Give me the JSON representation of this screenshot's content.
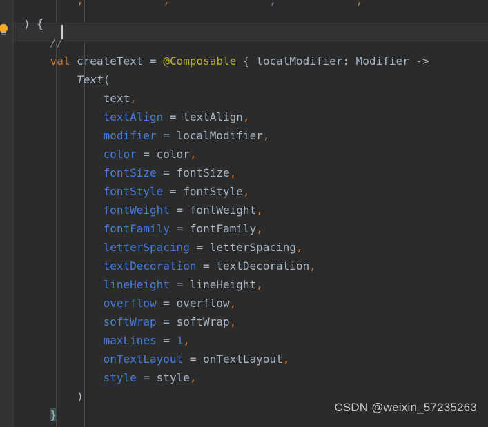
{
  "editor": {
    "theme_name": "darcula",
    "background_color": "#2b2b2b",
    "gutter_color": "#313335",
    "current_line_color": "#323232",
    "caret_color": "#cfcfcf",
    "language": "kotlin"
  },
  "gutter": {
    "intention_icon": "lightbulb-icon",
    "intention_icon_color": "#f5a623"
  },
  "lines": [
    {
      "index": 0,
      "clipped": true,
      "tokens": [
        {
          "text": "        ",
          "type": "default"
        },
        {
          "text": ",",
          "type": "comma"
        },
        {
          "text": "            ",
          "type": "default"
        },
        {
          "text": ",",
          "type": "comma"
        },
        {
          "text": "               ",
          "type": "default"
        },
        {
          "text": ",",
          "type": "local"
        },
        {
          "text": "            ",
          "type": "default"
        },
        {
          "text": ",",
          "type": "comma"
        }
      ]
    },
    {
      "index": 1,
      "tokens": [
        {
          "text": ") {",
          "type": "brace"
        }
      ]
    },
    {
      "index": 2,
      "current": true,
      "tokens": [
        {
          "text": "    ",
          "type": "default"
        },
        {
          "text": "// ",
          "type": "comment"
        }
      ]
    },
    {
      "index": 3,
      "tokens": [
        {
          "text": "    ",
          "type": "default"
        },
        {
          "text": "val",
          "type": "keyword"
        },
        {
          "text": " createText ",
          "type": "ident"
        },
        {
          "text": "=",
          "type": "default"
        },
        {
          "text": " ",
          "type": "default"
        },
        {
          "text": "@Composable",
          "type": "anno"
        },
        {
          "text": " { localModifier: Modifier ->",
          "type": "default"
        }
      ]
    },
    {
      "index": 4,
      "tokens": [
        {
          "text": "        ",
          "type": "default"
        },
        {
          "text": "Text",
          "type": "func"
        },
        {
          "text": "(",
          "type": "default"
        }
      ]
    },
    {
      "index": 5,
      "tokens": [
        {
          "text": "            ",
          "type": "default"
        },
        {
          "text": "text",
          "type": "ident"
        },
        {
          "text": ",",
          "type": "comma"
        }
      ]
    },
    {
      "index": 6,
      "tokens": [
        {
          "text": "            ",
          "type": "default"
        },
        {
          "text": "textAlign",
          "type": "param"
        },
        {
          "text": " = ",
          "type": "default"
        },
        {
          "text": "textAlign",
          "type": "ident"
        },
        {
          "text": ",",
          "type": "comma"
        }
      ]
    },
    {
      "index": 7,
      "tokens": [
        {
          "text": "            ",
          "type": "default"
        },
        {
          "text": "modifier",
          "type": "param"
        },
        {
          "text": " = ",
          "type": "default"
        },
        {
          "text": "localModifier",
          "type": "ident"
        },
        {
          "text": ",",
          "type": "comma"
        }
      ]
    },
    {
      "index": 8,
      "tokens": [
        {
          "text": "            ",
          "type": "default"
        },
        {
          "text": "color",
          "type": "param"
        },
        {
          "text": " = ",
          "type": "default"
        },
        {
          "text": "color",
          "type": "ident"
        },
        {
          "text": ",",
          "type": "comma"
        }
      ]
    },
    {
      "index": 9,
      "tokens": [
        {
          "text": "            ",
          "type": "default"
        },
        {
          "text": "fontSize",
          "type": "param"
        },
        {
          "text": " = ",
          "type": "default"
        },
        {
          "text": "fontSize",
          "type": "ident"
        },
        {
          "text": ",",
          "type": "comma"
        }
      ]
    },
    {
      "index": 10,
      "tokens": [
        {
          "text": "            ",
          "type": "default"
        },
        {
          "text": "fontStyle",
          "type": "param"
        },
        {
          "text": " = ",
          "type": "default"
        },
        {
          "text": "fontStyle",
          "type": "ident"
        },
        {
          "text": ",",
          "type": "comma"
        }
      ]
    },
    {
      "index": 11,
      "tokens": [
        {
          "text": "            ",
          "type": "default"
        },
        {
          "text": "fontWeight",
          "type": "param"
        },
        {
          "text": " = ",
          "type": "default"
        },
        {
          "text": "fontWeight",
          "type": "ident"
        },
        {
          "text": ",",
          "type": "comma"
        }
      ]
    },
    {
      "index": 12,
      "tokens": [
        {
          "text": "            ",
          "type": "default"
        },
        {
          "text": "fontFamily",
          "type": "param"
        },
        {
          "text": " = ",
          "type": "default"
        },
        {
          "text": "fontFamily",
          "type": "ident"
        },
        {
          "text": ",",
          "type": "comma"
        }
      ]
    },
    {
      "index": 13,
      "tokens": [
        {
          "text": "            ",
          "type": "default"
        },
        {
          "text": "letterSpacing",
          "type": "param"
        },
        {
          "text": " = ",
          "type": "default"
        },
        {
          "text": "letterSpacing",
          "type": "ident"
        },
        {
          "text": ",",
          "type": "comma"
        }
      ]
    },
    {
      "index": 14,
      "tokens": [
        {
          "text": "            ",
          "type": "default"
        },
        {
          "text": "textDecoration",
          "type": "param"
        },
        {
          "text": " = ",
          "type": "default"
        },
        {
          "text": "textDecoration",
          "type": "ident"
        },
        {
          "text": ",",
          "type": "comma"
        }
      ]
    },
    {
      "index": 15,
      "tokens": [
        {
          "text": "            ",
          "type": "default"
        },
        {
          "text": "lineHeight",
          "type": "param"
        },
        {
          "text": " = ",
          "type": "default"
        },
        {
          "text": "lineHeight",
          "type": "ident"
        },
        {
          "text": ",",
          "type": "comma"
        }
      ]
    },
    {
      "index": 16,
      "tokens": [
        {
          "text": "            ",
          "type": "default"
        },
        {
          "text": "overflow",
          "type": "param"
        },
        {
          "text": " = ",
          "type": "default"
        },
        {
          "text": "overflow",
          "type": "ident"
        },
        {
          "text": ",",
          "type": "comma"
        }
      ]
    },
    {
      "index": 17,
      "tokens": [
        {
          "text": "            ",
          "type": "default"
        },
        {
          "text": "softWrap",
          "type": "param"
        },
        {
          "text": " = ",
          "type": "default"
        },
        {
          "text": "softWrap",
          "type": "ident"
        },
        {
          "text": ",",
          "type": "comma"
        }
      ]
    },
    {
      "index": 18,
      "tokens": [
        {
          "text": "            ",
          "type": "default"
        },
        {
          "text": "maxLines",
          "type": "param"
        },
        {
          "text": " = ",
          "type": "default"
        },
        {
          "text": "1",
          "type": "number"
        },
        {
          "text": ",",
          "type": "comma"
        }
      ]
    },
    {
      "index": 19,
      "tokens": [
        {
          "text": "            ",
          "type": "default"
        },
        {
          "text": "onTextLayout",
          "type": "param"
        },
        {
          "text": " = ",
          "type": "default"
        },
        {
          "text": "onTextLayout",
          "type": "ident"
        },
        {
          "text": ",",
          "type": "comma"
        }
      ]
    },
    {
      "index": 20,
      "tokens": [
        {
          "text": "            ",
          "type": "default"
        },
        {
          "text": "style",
          "type": "param"
        },
        {
          "text": " = ",
          "type": "default"
        },
        {
          "text": "style",
          "type": "ident"
        },
        {
          "text": ",",
          "type": "comma"
        }
      ]
    },
    {
      "index": 21,
      "tokens": [
        {
          "text": "        ",
          "type": "default"
        },
        {
          "text": ")",
          "type": "brace"
        }
      ]
    },
    {
      "index": 22,
      "tokens": [
        {
          "text": "    ",
          "type": "default"
        },
        {
          "text": "}",
          "type": "brace-hl"
        }
      ]
    }
  ],
  "watermark": {
    "text": "CSDN @weixin_57235263"
  }
}
